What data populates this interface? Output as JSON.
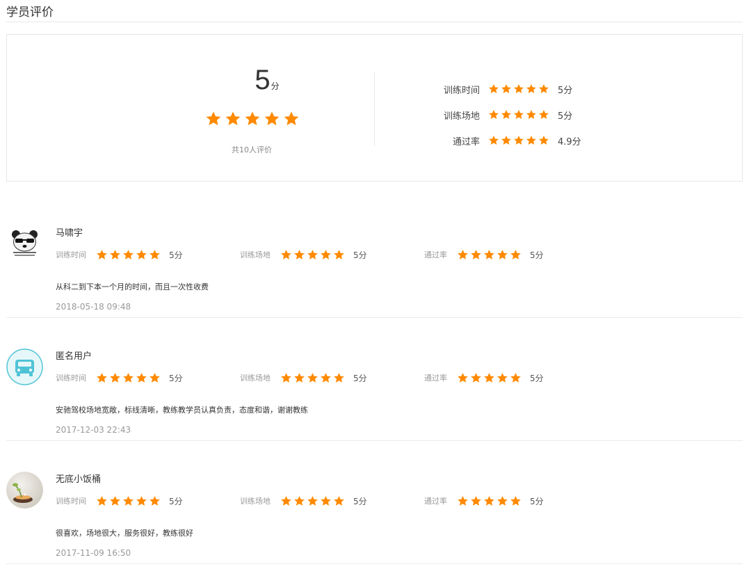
{
  "section_title": "学员评价",
  "summary": {
    "score": "5",
    "score_unit": "分",
    "stars": 5,
    "total_text": "共10人评价",
    "rows": [
      {
        "label": "训练时间",
        "stars": 5,
        "value": "5分"
      },
      {
        "label": "训练场地",
        "stars": 5,
        "value": "5分"
      },
      {
        "label": "通过率",
        "stars": 5,
        "value": "4.9分"
      }
    ]
  },
  "reviews": [
    {
      "name": "马啸宇",
      "avatar": "panda-meme-avatar",
      "ratings": [
        {
          "label": "训练时间",
          "stars": 5,
          "value": "5分"
        },
        {
          "label": "训练场地",
          "stars": 5,
          "value": "5分"
        },
        {
          "label": "通过率",
          "stars": 5,
          "value": "5分"
        }
      ],
      "comment": "从科二到下本一个月的时间，而且一次性收费",
      "date": "2018-05-18 09:48"
    },
    {
      "name": "匿名用户",
      "avatar": "car-icon-avatar",
      "ratings": [
        {
          "label": "训练时间",
          "stars": 5,
          "value": "5分"
        },
        {
          "label": "训练场地",
          "stars": 5,
          "value": "5分"
        },
        {
          "label": "通过率",
          "stars": 5,
          "value": "5分"
        }
      ],
      "comment": "安驰驾校场地宽敞，标线清晰，教练教学员认真负责，态度和谐，谢谢教练",
      "date": "2017-12-03 22:43"
    },
    {
      "name": "无底小饭桶",
      "avatar": "plant-photo-avatar",
      "ratings": [
        {
          "label": "训练时间",
          "stars": 5,
          "value": "5分"
        },
        {
          "label": "训练场地",
          "stars": 5,
          "value": "5分"
        },
        {
          "label": "通过率",
          "stars": 5,
          "value": "5分"
        }
      ],
      "comment": "很喜欢，场地很大，服务很好，教练很好",
      "date": "2017-11-09 16:50"
    }
  ],
  "colors": {
    "star": "#ff8a00",
    "car_avatar_bg": "#e6f7f9",
    "car_avatar_accent": "#4fc3d6"
  }
}
